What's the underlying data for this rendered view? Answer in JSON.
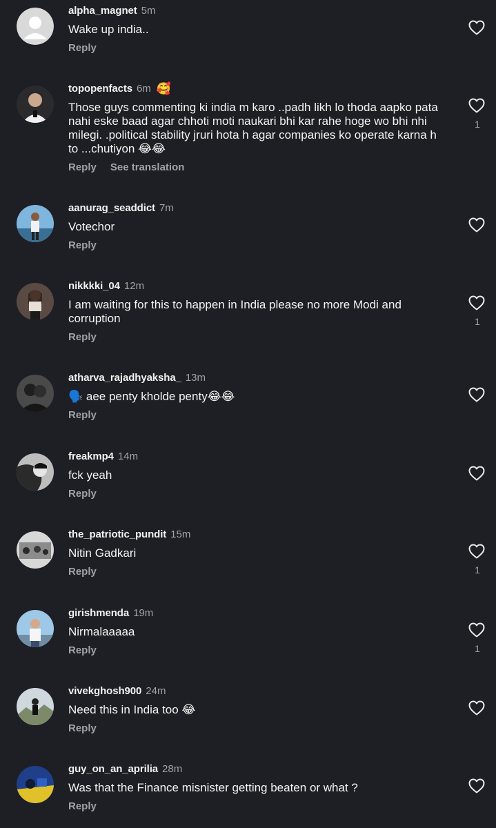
{
  "comments": [
    {
      "username": "alpha_magnet",
      "time": "5m",
      "text": "Wake up india..",
      "reply": "Reply",
      "translate": "",
      "like_count": "",
      "reaction": ""
    },
    {
      "username": "topopenfacts",
      "time": "6m",
      "text": "Those guys commenting ki india m karo ..padh likh lo thoda aapko pata nahi eske baad agar chhoti moti naukari bhi kar rahe hoge wo bhi nhi milegi. .political stability jruri hota h agar companies ko operate karna h to ...chutiyon 😂😂",
      "reply": "Reply",
      "translate": "See translation",
      "like_count": "1",
      "reaction": "🥰"
    },
    {
      "username": "aanurag_seaddict",
      "time": "7m",
      "text": "Votechor",
      "reply": "Reply",
      "translate": "",
      "like_count": "",
      "reaction": ""
    },
    {
      "username": "nikkkki_04",
      "time": "12m",
      "text": "I am waiting for this to happen in India please no more Modi and corruption",
      "reply": "Reply",
      "translate": "",
      "like_count": "1",
      "reaction": ""
    },
    {
      "username": "atharva_rajadhyaksha_",
      "time": "13m",
      "text": "🗣️ aee penty kholde penty😂😂",
      "reply": "Reply",
      "translate": "",
      "like_count": "",
      "reaction": ""
    },
    {
      "username": "freakmp4",
      "time": "14m",
      "text": "fck yeah",
      "reply": "Reply",
      "translate": "",
      "like_count": "",
      "reaction": ""
    },
    {
      "username": "the_patriotic_pundit",
      "time": "15m",
      "text": "Nitin Gadkari",
      "reply": "Reply",
      "translate": "",
      "like_count": "1",
      "reaction": ""
    },
    {
      "username": "girishmenda",
      "time": "19m",
      "text": "Nirmalaaaaa",
      "reply": "Reply",
      "translate": "",
      "like_count": "1",
      "reaction": ""
    },
    {
      "username": "vivekghosh900",
      "time": "24m",
      "text": "Need this in India too 😂",
      "reply": "Reply",
      "translate": "",
      "like_count": "",
      "reaction": ""
    },
    {
      "username": "guy_on_an_aprilia",
      "time": "28m",
      "text": "Was that the Finance misnister getting beaten or what ?",
      "reply": "Reply",
      "translate": "",
      "like_count": "",
      "reaction": ""
    }
  ],
  "colors": {
    "background": "#1e1f24",
    "primary_text": "#f2f2f2",
    "secondary_text": "#a0a2a8"
  },
  "icons": {
    "like": "heart-outline-icon",
    "avatar": "profile-photo"
  }
}
